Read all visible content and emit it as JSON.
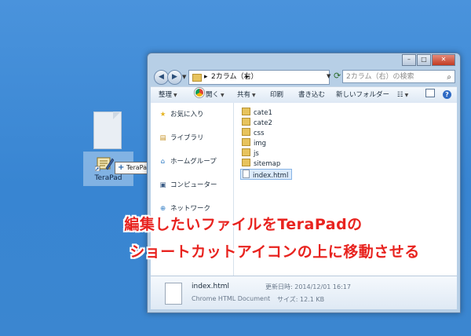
{
  "desktop": {
    "shortcut_label": "TeraPad",
    "drag_tooltip": "TeraPad で開く",
    "drag_tooltip_plus": "+"
  },
  "window": {
    "buttons": {
      "min": "–",
      "max": "□",
      "close": "✕"
    },
    "address": {
      "path_segment": "2カラム（右）",
      "separator": "▸",
      "search_placeholder": "2カラム（右）の検索"
    },
    "toolbar": {
      "organize": "整理",
      "open": "開く",
      "share": "共有",
      "print": "印刷",
      "burn": "書き込む",
      "new_folder": "新しいフォルダー",
      "help": "?"
    },
    "nav": [
      {
        "label": "お気に入り",
        "icon": "star-icon"
      },
      {
        "label": "ライブラリ",
        "icon": "library-icon"
      },
      {
        "label": "ホームグループ",
        "icon": "homegroup-icon"
      },
      {
        "label": "コンピューター",
        "icon": "computer-icon"
      },
      {
        "label": "ネットワーク",
        "icon": "network-icon"
      }
    ],
    "files": [
      {
        "name": "cate1",
        "kind": "folder"
      },
      {
        "name": "cate2",
        "kind": "folder"
      },
      {
        "name": "css",
        "kind": "folder"
      },
      {
        "name": "img",
        "kind": "folder"
      },
      {
        "name": "js",
        "kind": "folder"
      },
      {
        "name": "sitemap",
        "kind": "folder"
      },
      {
        "name": "index.html",
        "kind": "file",
        "selected": true
      }
    ],
    "details": {
      "filename": "index.html",
      "type": "Chrome HTML Document",
      "date_label": "更新日時: 2014/12/01 16:17",
      "size_label": "サイズ: 12.1 KB"
    }
  },
  "caption": {
    "line1": "編集したいファイルをTeraPadの",
    "line2": "ショートカットアイコンの上に移動させる"
  }
}
